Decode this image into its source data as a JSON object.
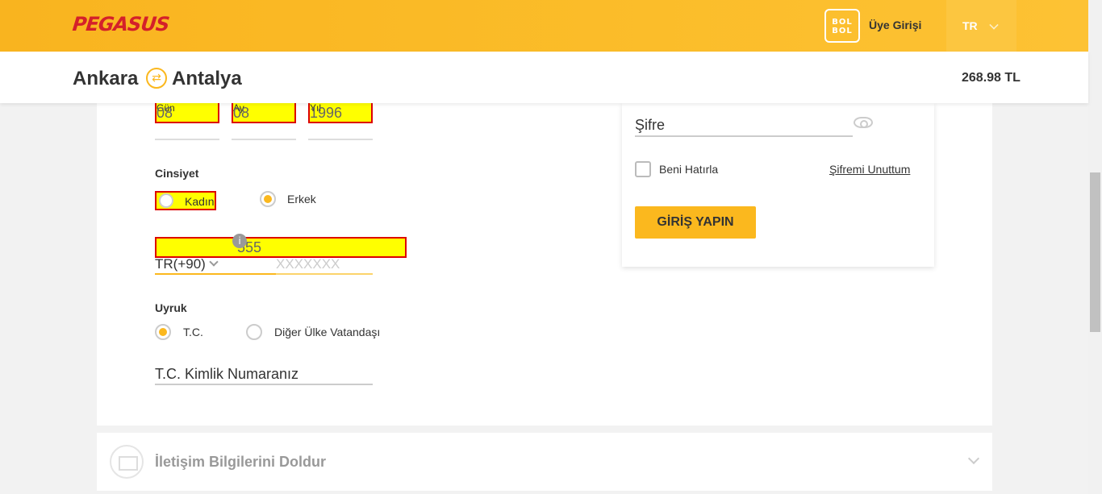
{
  "header": {
    "logo": "PEGASUS",
    "bolbol_line1": "BOL",
    "bolbol_line2": "BOL",
    "member_login": "Üye Girişi",
    "language": "TR"
  },
  "route": {
    "origin": "Ankara",
    "destination": "Antalya",
    "swap_icon": "⇄",
    "price": "268.98 TL"
  },
  "birthdate": {
    "day_label": "Gün",
    "day_value": "08",
    "month_label": "Ay",
    "month_value": "08",
    "year_label": "Yıl",
    "year_value": "1996"
  },
  "gender": {
    "label": "Cinsiyet",
    "options": [
      {
        "label": "Kadın",
        "selected": false
      },
      {
        "label": "Erkek",
        "selected": true
      }
    ]
  },
  "phone": {
    "value": "555",
    "country_code": "TR(+90)",
    "placeholder": "XXXXXXX",
    "info_icon": "i"
  },
  "nationality": {
    "label": "Uyruk",
    "options": [
      {
        "label": "T.C.",
        "selected": true
      },
      {
        "label": "Diğer Ülke Vatandaşı",
        "selected": false
      }
    ]
  },
  "tc_id": {
    "placeholder": "T.C. Kimlik Numaranız"
  },
  "login": {
    "password_label": "Şifre",
    "remember_me": "Beni Hatırla",
    "forgot_password": "Şifremi Unuttum",
    "submit": "GİRİŞ YAPIN"
  },
  "contact_section": {
    "title": "İletişim Bilgilerini Doldur"
  },
  "colors": {
    "brand_yellow": "#fbb81e",
    "brand_red": "#d4202a",
    "highlight": "#ffff00"
  }
}
